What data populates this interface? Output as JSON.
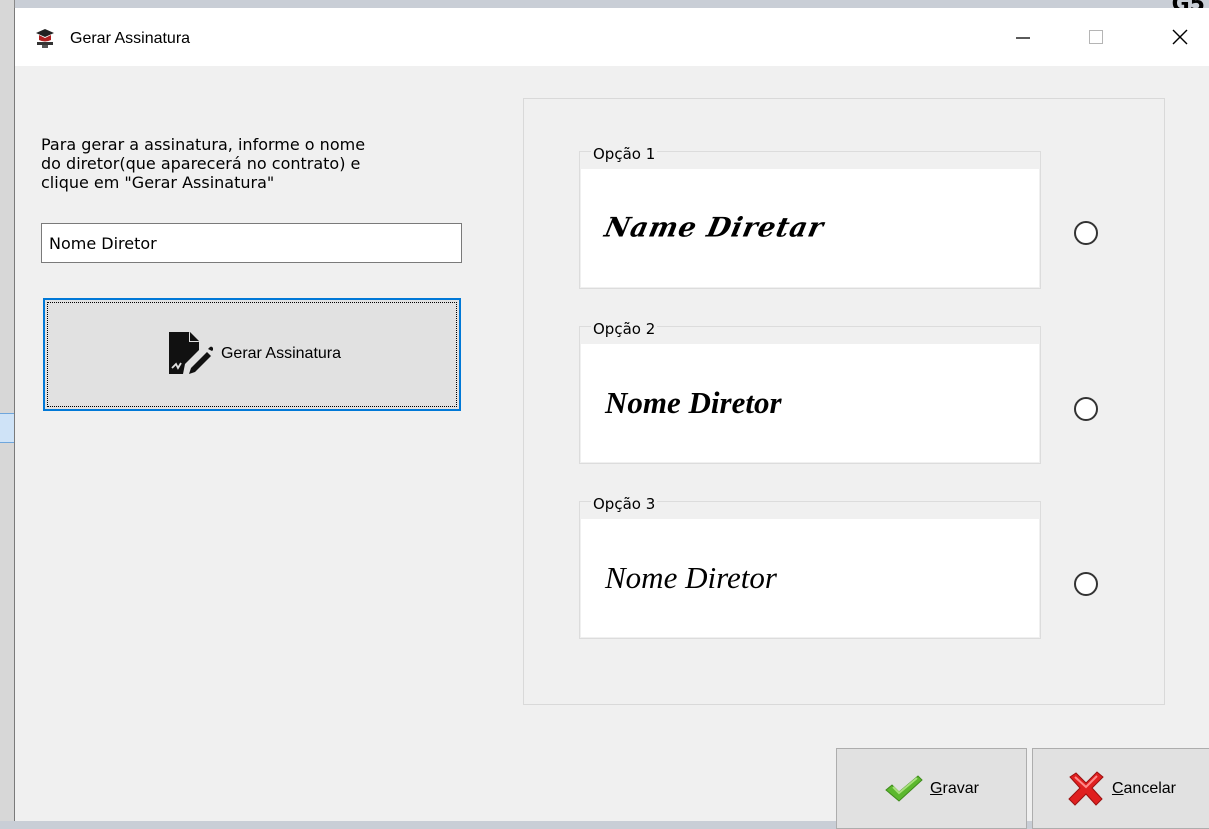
{
  "window": {
    "title": "Gerar Assinatura",
    "minimize_glyph": "—",
    "maximize_glyph": "☐",
    "close_glyph": "✕"
  },
  "background": {
    "corner_text": "G5"
  },
  "form": {
    "instruction_lines": [
      "Para gerar a assinatura, informe o nome",
      "do diretor(que aparecerá no contrato) e",
      "clique em \"Gerar Assinatura\""
    ],
    "director_name_value": "Nome Diretor",
    "generate_button_label": "Gerar Assinatura"
  },
  "options": [
    {
      "legend": "Opção 1",
      "signature": "Name Diretar"
    },
    {
      "legend": "Opção 2",
      "signature": "Nome Diretor"
    },
    {
      "legend": "Opção 3",
      "signature": "Nome Diretor"
    }
  ],
  "buttons": {
    "save_hotkey": "G",
    "save_rest": "ravar",
    "cancel_hotkey": "C",
    "cancel_rest": "ancelar"
  },
  "colors": {
    "accent": "#0078d7",
    "save_icon": "#5cb82e",
    "cancel_icon": "#e02020"
  }
}
